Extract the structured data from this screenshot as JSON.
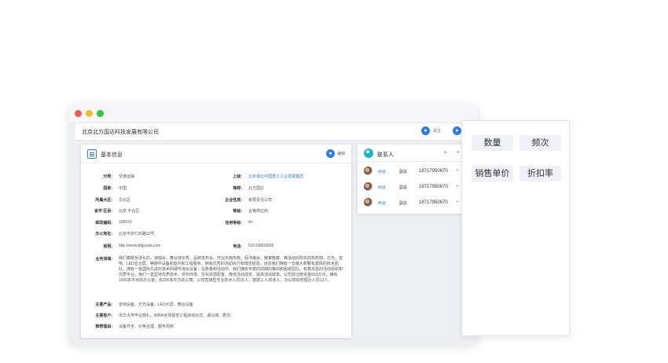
{
  "window": {
    "controls": [
      "close",
      "minimize",
      "maximize"
    ]
  },
  "company_bar": {
    "name": "北京北方国达科技发展有限公司",
    "follow_label": "关注",
    "follow_icon": "person-icon"
  },
  "basic_info": {
    "title": "基本信息",
    "edit_label": "编辑",
    "fields_left": [
      {
        "label": "分类:",
        "value": "交通运输"
      },
      {
        "label": "国家:",
        "value": "中国"
      },
      {
        "label": "所属大区:",
        "value": "华北区"
      },
      {
        "label": "省市 区县:",
        "value": "北京 丰台区"
      },
      {
        "label": "邮政编码:",
        "value": "100070"
      },
      {
        "label": "办公地址:",
        "value": "北京市崇仁时路22号"
      },
      {
        "label": "官网:",
        "value": "http://www.bfguoda.com"
      }
    ],
    "fields_right": [
      {
        "label": "上级:",
        "value": "北京城北中国重工工业发展集团",
        "link": true
      },
      {
        "label": "简称:",
        "value": "北方国达"
      },
      {
        "label": "企业性质:",
        "value": "有限责任公司"
      },
      {
        "label": "等级:",
        "value": "合格供应商"
      },
      {
        "label": "信用等级:",
        "value": "A+"
      },
      {
        "label": "电话:",
        "value": "010-69603965"
      }
    ],
    "business_label": "业务领域:",
    "business_text": "我们着眼全球化的，演唱会、舞台演示秀、品牌发布会、开业庆典庆典、经济峰会、晚宴晚宴、等活动的购买的构想感。灯光、音响、LED显示屏、等硬件设备和软件和工程服务，拥有优秀的活动执行和博览经验，目前我们拥有一支偏大和著有激情的技术团队，拥有一批国际先进的技术的硬件演出设备，在数量和活动中、我们拥有丰富的前期的策划和图纸团队，有着完善的活动组织和优质平台，我们一直坚持优质技术、现代环境、优化资源配置、降低活动成本、提高活动效率。公司现注册资金500万元，拥有1000多平米的办公室，有200多平方的公寓。公司直接型专业技术人员15人，搭建工人30多人，办公财综管理近人员12人。",
    "products_label": "主要产品:",
    "products_value": "音响设备、灯光设备、LED大屏、舞台设备",
    "clients_label": "主要客户:",
    "clients_value": "清华大学毕业典礼、BMW全球报查工程启动仪式、湖北城、肥讯",
    "recommend_label": "推荐理由:",
    "recommend_value": "设备齐全、价格合理、服务周到"
  },
  "contacts": {
    "title": "联系人",
    "add_icon": "plus-icon",
    "items": [
      {
        "name": "树远",
        "role": "副总",
        "phone": "18717950670"
      },
      {
        "name": "树远",
        "role": "副总",
        "phone": "18717950670"
      },
      {
        "name": "树远",
        "role": "副总",
        "phone": "18717950670"
      }
    ]
  },
  "side_panel": {
    "chips": [
      "数量",
      "频次",
      "销售单价",
      "折扣率"
    ]
  }
}
